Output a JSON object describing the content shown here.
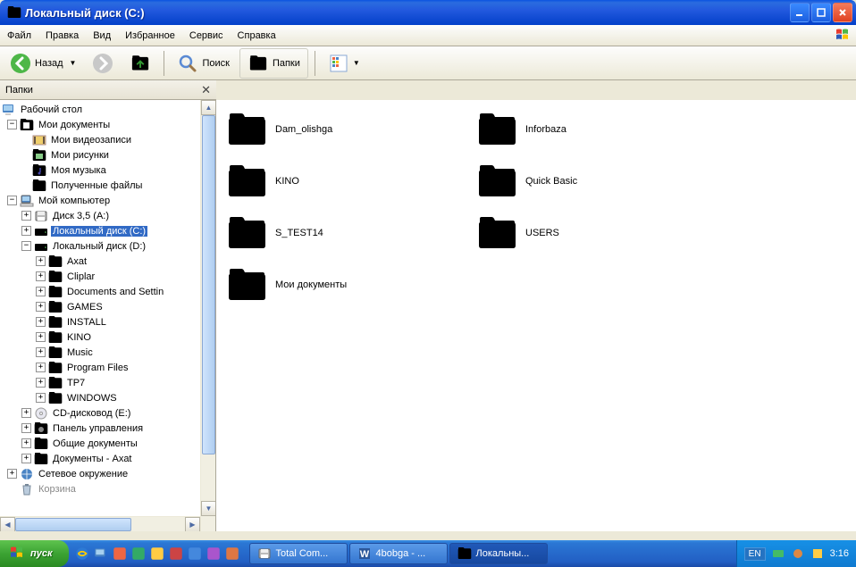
{
  "window": {
    "title": "Локальный диск (C:)"
  },
  "menu": {
    "file": "Файл",
    "edit": "Правка",
    "view": "Вид",
    "favorites": "Избранное",
    "tools": "Сервис",
    "help": "Справка"
  },
  "toolbar": {
    "back": "Назад",
    "search": "Поиск",
    "folders": "Папки"
  },
  "sidebar": {
    "title": "Папки"
  },
  "tree": {
    "desktop": "Рабочий стол",
    "mydocs": "Мои документы",
    "myvideos": "Мои видеозаписи",
    "mypics": "Мои рисунки",
    "mymusic": "Моя музыка",
    "received": "Полученные файлы",
    "mycomputer": "Мой компьютер",
    "floppy": "Диск 3,5 (A:)",
    "diskc": "Локальный диск (C:)",
    "diskd": "Локальный диск (D:)",
    "axat": "Axat",
    "cliplar": "Cliplar",
    "docs_settings": "Documents and Settin",
    "games": "GAMES",
    "install": "INSTALL",
    "kino": "KINO",
    "music": "Music",
    "progfiles": "Program Files",
    "tp7": "TP7",
    "windows": "WINDOWS",
    "cddrive": "CD-дисковод (E:)",
    "ctrlpanel": "Панель управления",
    "shareddocs": "Общие документы",
    "axatdocs": "Документы - Axat",
    "network": "Сетевое окружение",
    "recyclebin": "Корзина"
  },
  "folders": [
    {
      "name": "Dam_olishga"
    },
    {
      "name": "Inforbaza"
    },
    {
      "name": "KINO"
    },
    {
      "name": "Quick Basic"
    },
    {
      "name": "S_TEST14"
    },
    {
      "name": "USERS"
    },
    {
      "name": "Мои документы"
    }
  ],
  "taskbar": {
    "start": "пуск",
    "tasks": [
      {
        "label": "Total Com..."
      },
      {
        "label": "4bobga - ..."
      },
      {
        "label": "Локальны...",
        "active": true
      }
    ],
    "lang": "EN",
    "time": "3:16"
  }
}
